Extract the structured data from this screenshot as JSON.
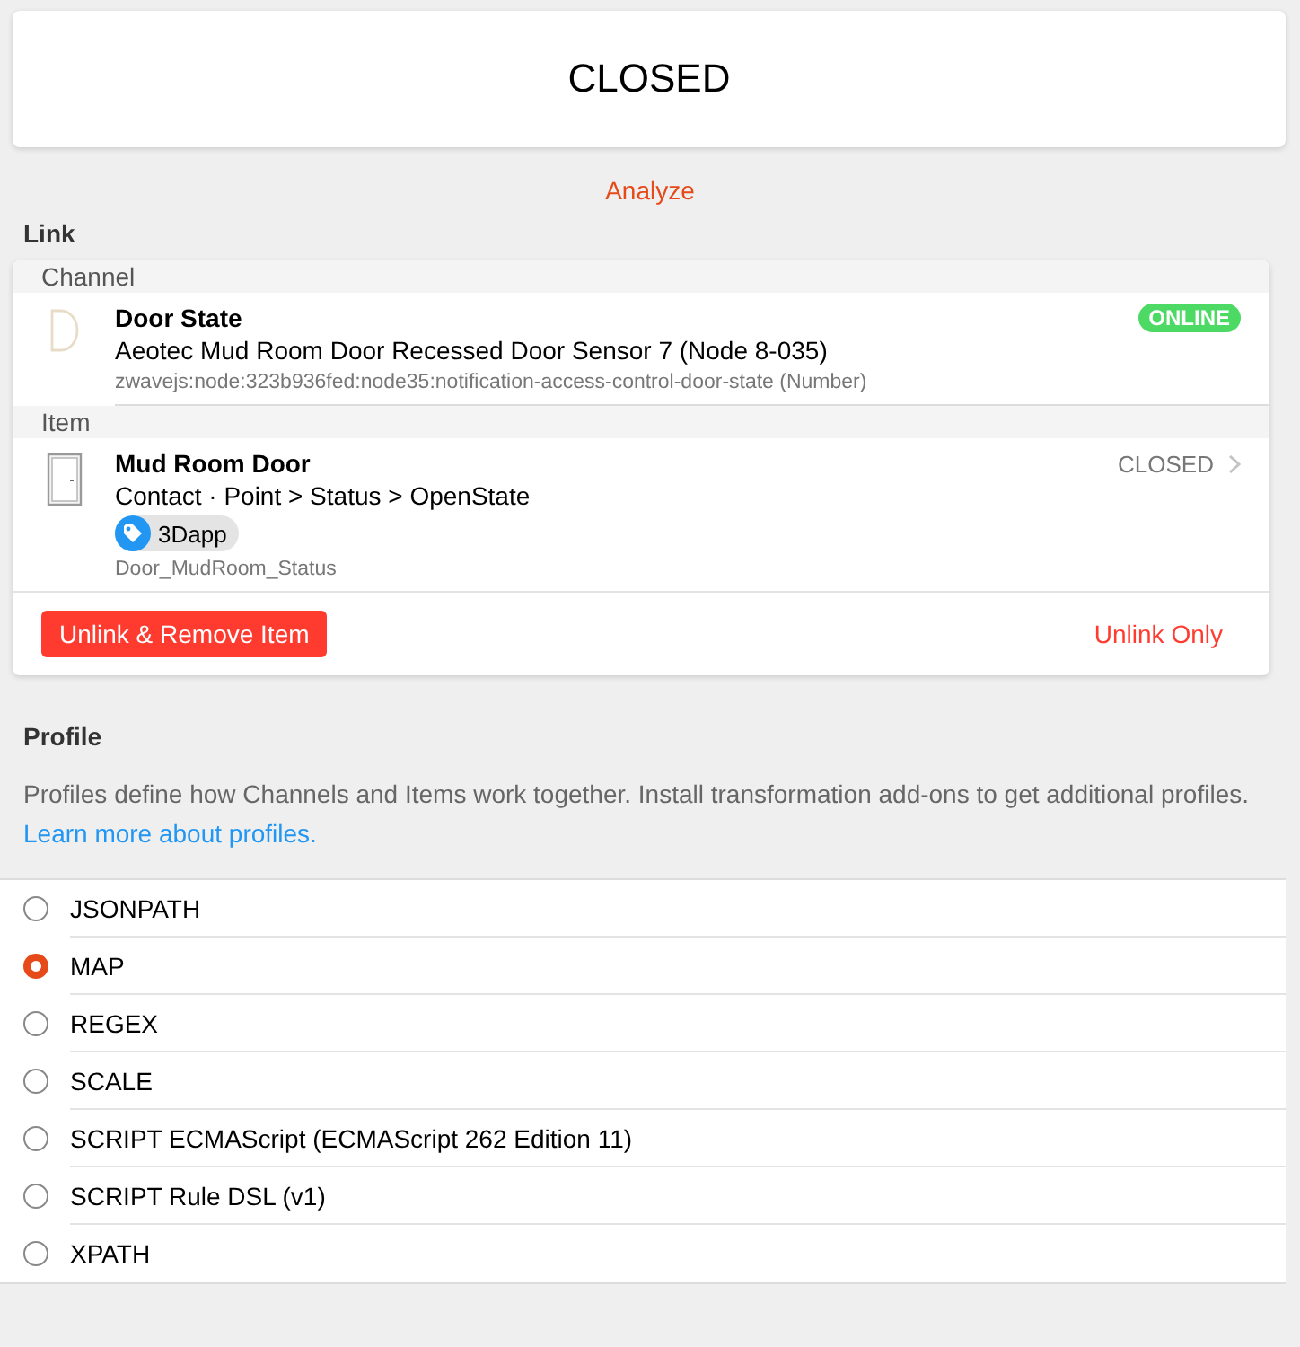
{
  "state_card": {
    "value": "CLOSED"
  },
  "analyze_link": "Analyze",
  "link": {
    "title": "Link",
    "channel": {
      "section_label": "Channel",
      "name": "Door State",
      "thing_label": "Aeotec Mud Room Door Recessed Door Sensor 7 (Node 8-035)",
      "uid": "zwavejs:node:323b936fed:node35:notification-access-control-door-state (Number)",
      "status": {
        "label": "ONLINE",
        "online": true
      }
    },
    "item": {
      "section_label": "Item",
      "name": "Mud Room Door",
      "type": "Contact · Point > Status > OpenState",
      "tags": [
        {
          "label": "3Dapp"
        }
      ],
      "item_name": "Door_MudRoom_Status",
      "state": "CLOSED"
    },
    "buttons": [
      {
        "label": "Unlink & Remove Item",
        "kind": "filled"
      },
      {
        "label": "Unlink Only",
        "kind": "text"
      }
    ]
  },
  "profile": {
    "title": "Profile",
    "description": "Profiles define how Channels and Items work together. Install transformation add-ons to get additional profiles.",
    "learn_more_link": "Learn more about profiles.",
    "options": [
      {
        "label": "JSONPATH",
        "selected": false
      },
      {
        "label": "MAP",
        "selected": true
      },
      {
        "label": "REGEX",
        "selected": false
      },
      {
        "label": "SCALE",
        "selected": false
      },
      {
        "label": "SCRIPT ECMAScript (ECMAScript 262 Edition 11)",
        "selected": false
      },
      {
        "label": "SCRIPT Rule DSL (v1)",
        "selected": false
      },
      {
        "label": "XPATH",
        "selected": false
      }
    ]
  }
}
